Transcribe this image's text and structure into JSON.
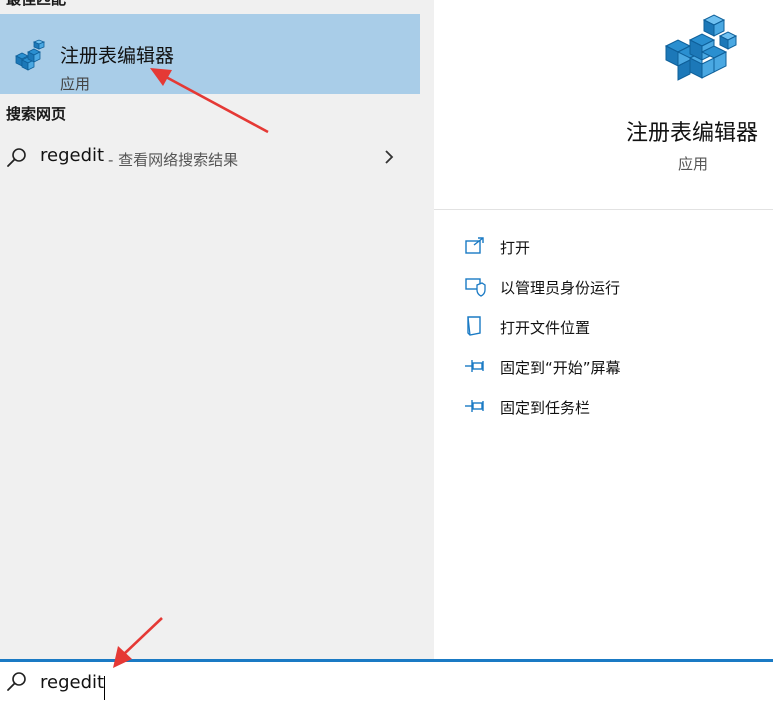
{
  "results": {
    "best_match_header": "最佳匹配",
    "best_match": {
      "name": "注册表编辑器",
      "type": "应用",
      "icon": "registry-editor-icon"
    },
    "web_header": "搜索网页",
    "web_result": {
      "query": "regedit",
      "suffix": "- 查看网络搜索结果"
    }
  },
  "preview": {
    "name": "注册表编辑器",
    "type": "应用",
    "actions": [
      {
        "label": "打开",
        "icon": "open-icon"
      },
      {
        "label": "以管理员身份运行",
        "icon": "run-as-admin-icon"
      },
      {
        "label": "打开文件位置",
        "icon": "file-location-icon"
      },
      {
        "label": "固定到“开始”屏幕",
        "icon": "pin-icon"
      },
      {
        "label": "固定到任务栏",
        "icon": "pin-icon"
      }
    ]
  },
  "search": {
    "value": "regedit"
  },
  "colors": {
    "selected_bg": "#a9cde8",
    "accent": "#1a7ac4",
    "annotation_arrow": "#e53935"
  }
}
